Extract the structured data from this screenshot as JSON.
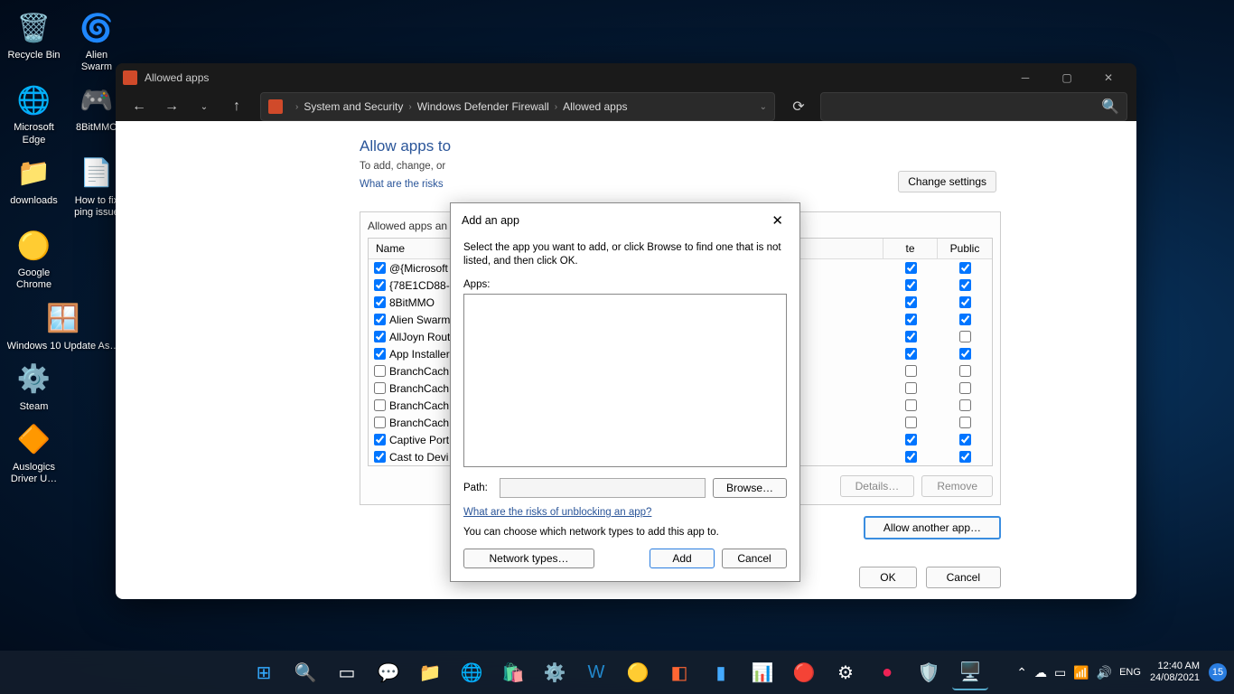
{
  "desktop": {
    "icons": [
      {
        "label": "Recycle Bin",
        "glyph": "🗑️"
      },
      {
        "label": "Alien Swarm",
        "glyph": "🌀"
      },
      {
        "label": "Microsoft Edge",
        "glyph": "🌐"
      },
      {
        "label": "8BitMMO",
        "glyph": "🎮"
      },
      {
        "label": "downloads",
        "glyph": "📁"
      },
      {
        "label": "How to fix ping issue",
        "glyph": "📄"
      },
      {
        "label": "Google Chrome",
        "glyph": "🟡"
      },
      {
        "label": "Windows 10 Update As…",
        "glyph": "🪟"
      },
      {
        "label": "Steam",
        "glyph": "⚙️"
      },
      {
        "label": "Auslogics Driver U…",
        "glyph": "🔶"
      }
    ]
  },
  "window": {
    "title": "Allowed apps",
    "breadcrumb": [
      "System and Security",
      "Windows Defender Firewall",
      "Allowed apps"
    ]
  },
  "page": {
    "title": "Allow apps to",
    "subtitle": "To add, change, or",
    "risks_link": "What are the risks",
    "change_settings": "Change settings",
    "panel_title": "Allowed apps an",
    "columns": {
      "name": "Name",
      "private": "te",
      "public": "Public"
    },
    "apps": [
      {
        "checked": true,
        "name": "@{Microsoft",
        "priv": true,
        "pub": true
      },
      {
        "checked": true,
        "name": "{78E1CD88-4",
        "priv": true,
        "pub": true
      },
      {
        "checked": true,
        "name": "8BitMMO",
        "priv": true,
        "pub": true
      },
      {
        "checked": true,
        "name": "Alien Swarm",
        "priv": true,
        "pub": true
      },
      {
        "checked": true,
        "name": "AllJoyn Rout",
        "priv": true,
        "pub": false
      },
      {
        "checked": true,
        "name": "App Installer",
        "priv": true,
        "pub": true
      },
      {
        "checked": false,
        "name": "BranchCach",
        "priv": false,
        "pub": false
      },
      {
        "checked": false,
        "name": "BranchCach",
        "priv": false,
        "pub": false
      },
      {
        "checked": false,
        "name": "BranchCach",
        "priv": false,
        "pub": false
      },
      {
        "checked": false,
        "name": "BranchCach",
        "priv": false,
        "pub": false
      },
      {
        "checked": true,
        "name": "Captive Port",
        "priv": true,
        "pub": true
      },
      {
        "checked": true,
        "name": "Cast to Devi",
        "priv": true,
        "pub": true
      }
    ],
    "details_btn": "Details…",
    "remove_btn": "Remove",
    "allow_another": "Allow another app…",
    "ok": "OK",
    "cancel": "Cancel"
  },
  "dialog": {
    "title": "Add an app",
    "desc": "Select the app you want to add, or click Browse to find one that is not listed, and then click OK.",
    "apps_label": "Apps:",
    "path_label": "Path:",
    "browse": "Browse…",
    "risks_link": "What are the risks of unblocking an app?",
    "note": "You can choose which network types to add this app to.",
    "network_types": "Network types…",
    "add": "Add",
    "cancel": "Cancel"
  },
  "taskbar": {
    "time": "12:40 AM",
    "date": "24/08/2021",
    "badge": "15"
  }
}
